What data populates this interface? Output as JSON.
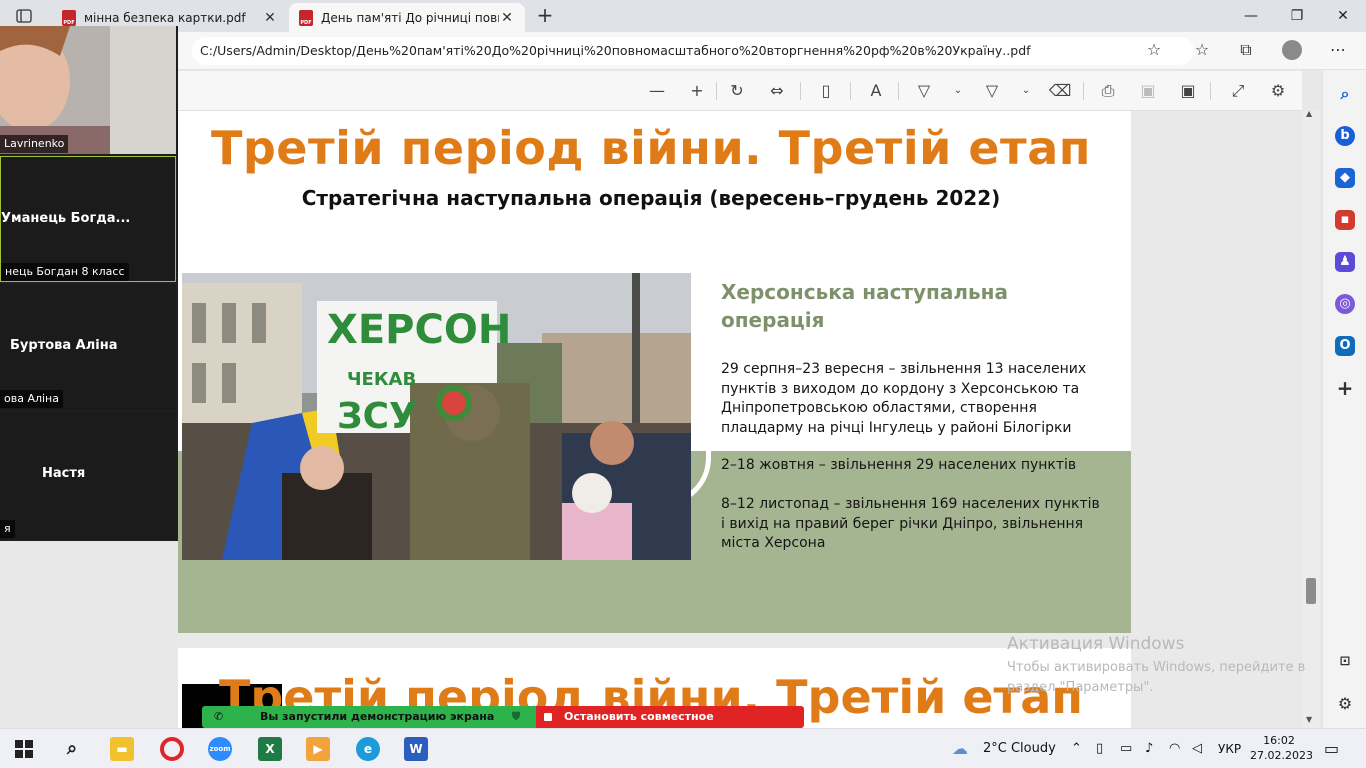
{
  "browser": {
    "tabs": [
      {
        "title": "мінна безпека картки.pdf",
        "active": false
      },
      {
        "title": "День пам'яті До річниці повном",
        "active": true
      }
    ],
    "url": "C:/Users/Admin/Desktop/День%20пам'яті%20До%20річниці%20повномасштабного%20вторгнення%20рф%20в%20Україну..pdf"
  },
  "slide": {
    "title": "Третій період війни. Третій етап",
    "subtitle": "Стратегічна наступальна операція (вересень–грудень 2022)",
    "heading": "Херсонська наступальна операція",
    "items": [
      "29 серпня–23 вересня – звільнення 13 населених пунктів з виходом до кордону з Херсонською та Дніпропетровською областями, створення плацдарму на річці Інгулець у районі Білогірки",
      "2–18 жовтня – звільнення 29 населених пунктів",
      "8–12 листопад – звільнення 169 населених пунктів і вихід на правий берег річки Дніпро, звільнення міста Херсона"
    ],
    "photo": {
      "sign_line1": "ХЕРСОН",
      "sign_line2": "ЧЕКАВ",
      "sign_line3": "ЗСУ"
    }
  },
  "page2": {
    "title": "Третій період війни. Третій етап"
  },
  "participants": [
    {
      "label": "Lavrinenko"
    },
    {
      "name": "Уманець  Богда...",
      "label": "нець Богдан 8 класс"
    },
    {
      "name": "Буртова Аліна",
      "label": "ова Аліна"
    },
    {
      "name": "Настя",
      "label": "я"
    }
  ],
  "share": {
    "notice": "Вы запустили демонстрацию экрана",
    "stop": "Остановить совместное использование"
  },
  "activation": {
    "title": "Активация Windows",
    "line": "Чтобы активировать Windows, перейдите в раздел \"Параметры\"."
  },
  "taskbar": {
    "weather": "2°C  Cloudy",
    "lang": "УКР",
    "time": "16:02",
    "date": "27.02.2023",
    "apps": [
      "file-explorer",
      "opera",
      "zoom",
      "excel",
      "video-editor",
      "edge",
      "word"
    ]
  },
  "colors": {
    "title_orange": "#e07c17",
    "green_band": "#a5b491",
    "heading_green": "#7f916a",
    "share_green": "#2eb24c",
    "share_red": "#e02424"
  }
}
